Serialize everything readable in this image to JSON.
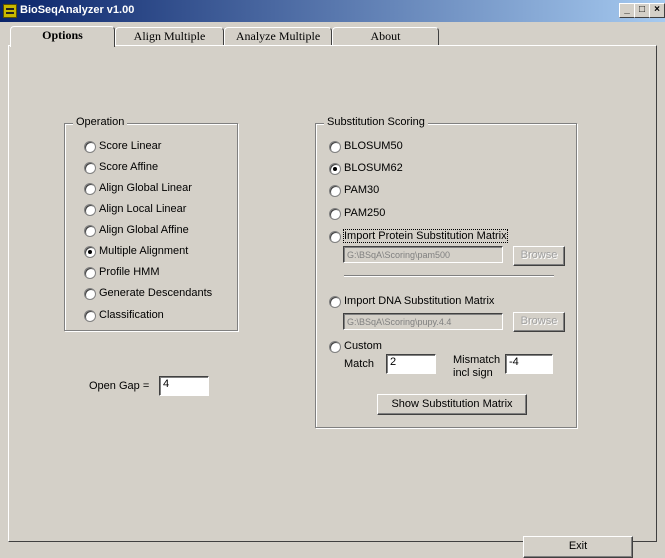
{
  "window": {
    "title": "BioSeqAnalyzer  v1.00",
    "minimize": "_",
    "maximize": "□",
    "close": "×"
  },
  "tabs": [
    {
      "label": "Options",
      "active": true
    },
    {
      "label": "Align Multiple"
    },
    {
      "label": "Analyze Multiple"
    },
    {
      "label": "About"
    }
  ],
  "operation": {
    "title": "Operation",
    "items": [
      {
        "label": "Score Linear",
        "selected": false
      },
      {
        "label": "Score Affine",
        "selected": false
      },
      {
        "label": "Align Global Linear",
        "selected": false
      },
      {
        "label": "Align Local Linear",
        "selected": false
      },
      {
        "label": "Align Global Affine",
        "selected": false
      },
      {
        "label": "Multiple Alignment",
        "selected": true
      },
      {
        "label": "Profile HMM",
        "selected": false
      },
      {
        "label": "Generate Descendants",
        "selected": false
      },
      {
        "label": "Classification",
        "selected": false
      }
    ]
  },
  "open_gap": {
    "label": "Open Gap =",
    "value": "4"
  },
  "scoring": {
    "title": "Substitution Scoring",
    "options": [
      {
        "label": "BLOSUM50",
        "selected": false
      },
      {
        "label": "BLOSUM62",
        "selected": true
      },
      {
        "label": "PAM30",
        "selected": false
      },
      {
        "label": "PAM250",
        "selected": false
      },
      {
        "label": "Import Protein Substitution Matrix",
        "selected": false
      },
      {
        "label": "Import DNA Substitution Matrix",
        "selected": false
      },
      {
        "label": "Custom",
        "selected": false
      }
    ],
    "protein_path": "G:\\BSqA\\Scoring\\pam500",
    "dna_path": "G:\\BSqA\\Scoring\\pupy.4.4",
    "browse_label": "Browse",
    "match_label": "Match",
    "match_value": "2",
    "mismatch_label_1": "Mismatch",
    "mismatch_label_2": "incl sign",
    "mismatch_value": "-4",
    "show_matrix_label": "Show Substitution Matrix"
  },
  "exit_label": "Exit"
}
